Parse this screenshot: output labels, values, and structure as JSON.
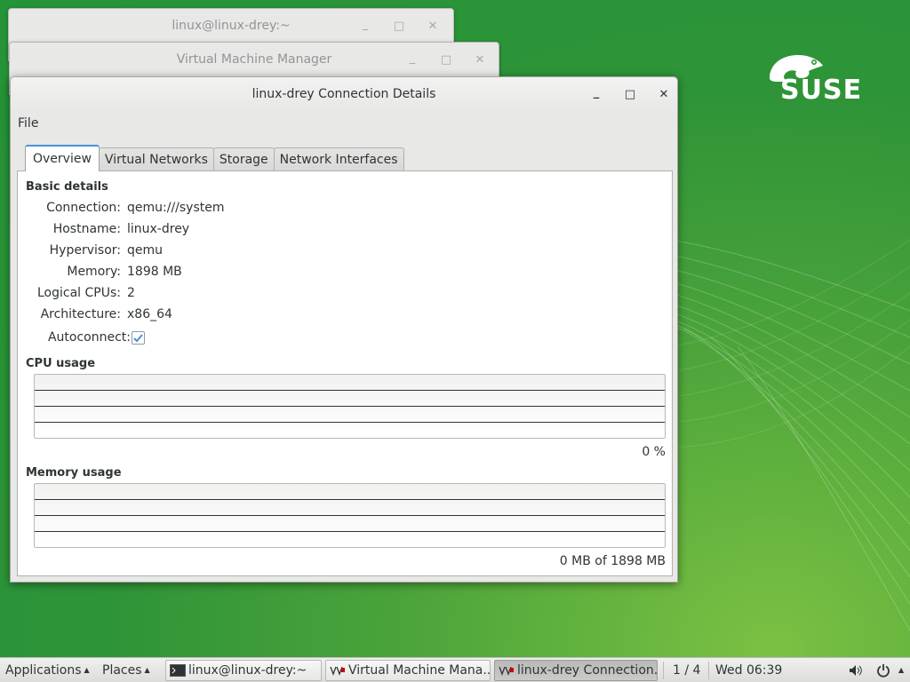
{
  "desktop": {
    "brand": "SUSE"
  },
  "windows": {
    "terminal": {
      "title": "linux@linux-drey:~"
    },
    "vmm": {
      "title": "Virtual Machine Manager"
    }
  },
  "dialog": {
    "title": "linux-drey Connection Details",
    "menu": {
      "file": "File"
    },
    "tabs": [
      "Overview",
      "Virtual Networks",
      "Storage",
      "Network Interfaces"
    ],
    "active_tab": "Overview",
    "basic_details": {
      "heading": "Basic details",
      "connection_label": "Connection:",
      "connection_value": "qemu:///system",
      "hostname_label": "Hostname:",
      "hostname_value": "linux-drey",
      "hypervisor_label": "Hypervisor:",
      "hypervisor_value": "qemu",
      "memory_label": "Memory:",
      "memory_value": "1898 MB",
      "cpus_label": "Logical CPUs:",
      "cpus_value": "2",
      "arch_label": "Architecture:",
      "arch_value": "x86_64",
      "autoconnect_label": "Autoconnect:",
      "autoconnect_checked": true
    },
    "cpu_usage": {
      "heading": "CPU usage",
      "value_text": "0 %"
    },
    "memory_usage": {
      "heading": "Memory usage",
      "value_text": "0 MB of 1898 MB"
    }
  },
  "taskbar": {
    "applications": "Applications",
    "places": "Places",
    "tasks": [
      {
        "label": "linux@linux-drey:~",
        "icon": "terminal-icon"
      },
      {
        "label": "Virtual Machine Mana...",
        "icon": "vmm-icon"
      },
      {
        "label": "linux-drey Connection...",
        "icon": "vmm-icon"
      }
    ],
    "workspace": "1 / 4",
    "clock": "Wed 06:39"
  },
  "colors": {
    "desktop_green": "#2f9438",
    "tab_accent": "#4a90d9",
    "checkbox_check": "#4a90d9"
  }
}
